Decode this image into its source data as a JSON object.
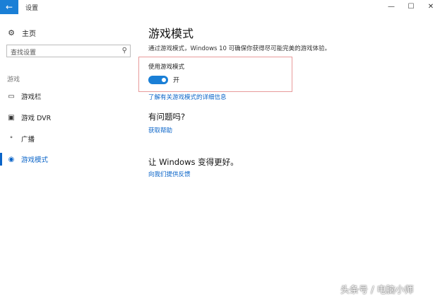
{
  "window": {
    "back_icon": "←",
    "title": "设置",
    "minimize_icon": "—",
    "maximize_icon": "☐",
    "close_icon": "✕"
  },
  "sidebar": {
    "home_label": "主页",
    "home_icon": "⚙",
    "search_placeholder": "查找设置",
    "search_icon": "⚲",
    "section_label": "游戏",
    "items": [
      {
        "label": "游戏栏",
        "icon": "▭"
      },
      {
        "label": "游戏 DVR",
        "icon": "▣"
      },
      {
        "label": "广播",
        "icon": "ᐤ"
      },
      {
        "label": "游戏模式",
        "icon": "◉"
      }
    ]
  },
  "main": {
    "title": "游戏模式",
    "description": "通过游戏模式，Windows 10 可确保你获得尽可能完美的游戏体验。",
    "toggle_label": "使用游戏模式",
    "toggle_state": "开",
    "toggle_on": true,
    "link_more": "了解有关游戏模式的详细信息",
    "question_heading": "有问题吗?",
    "link_help": "获取帮助",
    "better_heading": "让 Windows 变得更好。",
    "link_feedback": "向我们提供反馈"
  },
  "watermark": "头条号 / 电脑小师",
  "colors": {
    "accent": "#0a64c8",
    "toggle_on": "#1a7fd6",
    "highlight_border": "#e89b9b"
  }
}
